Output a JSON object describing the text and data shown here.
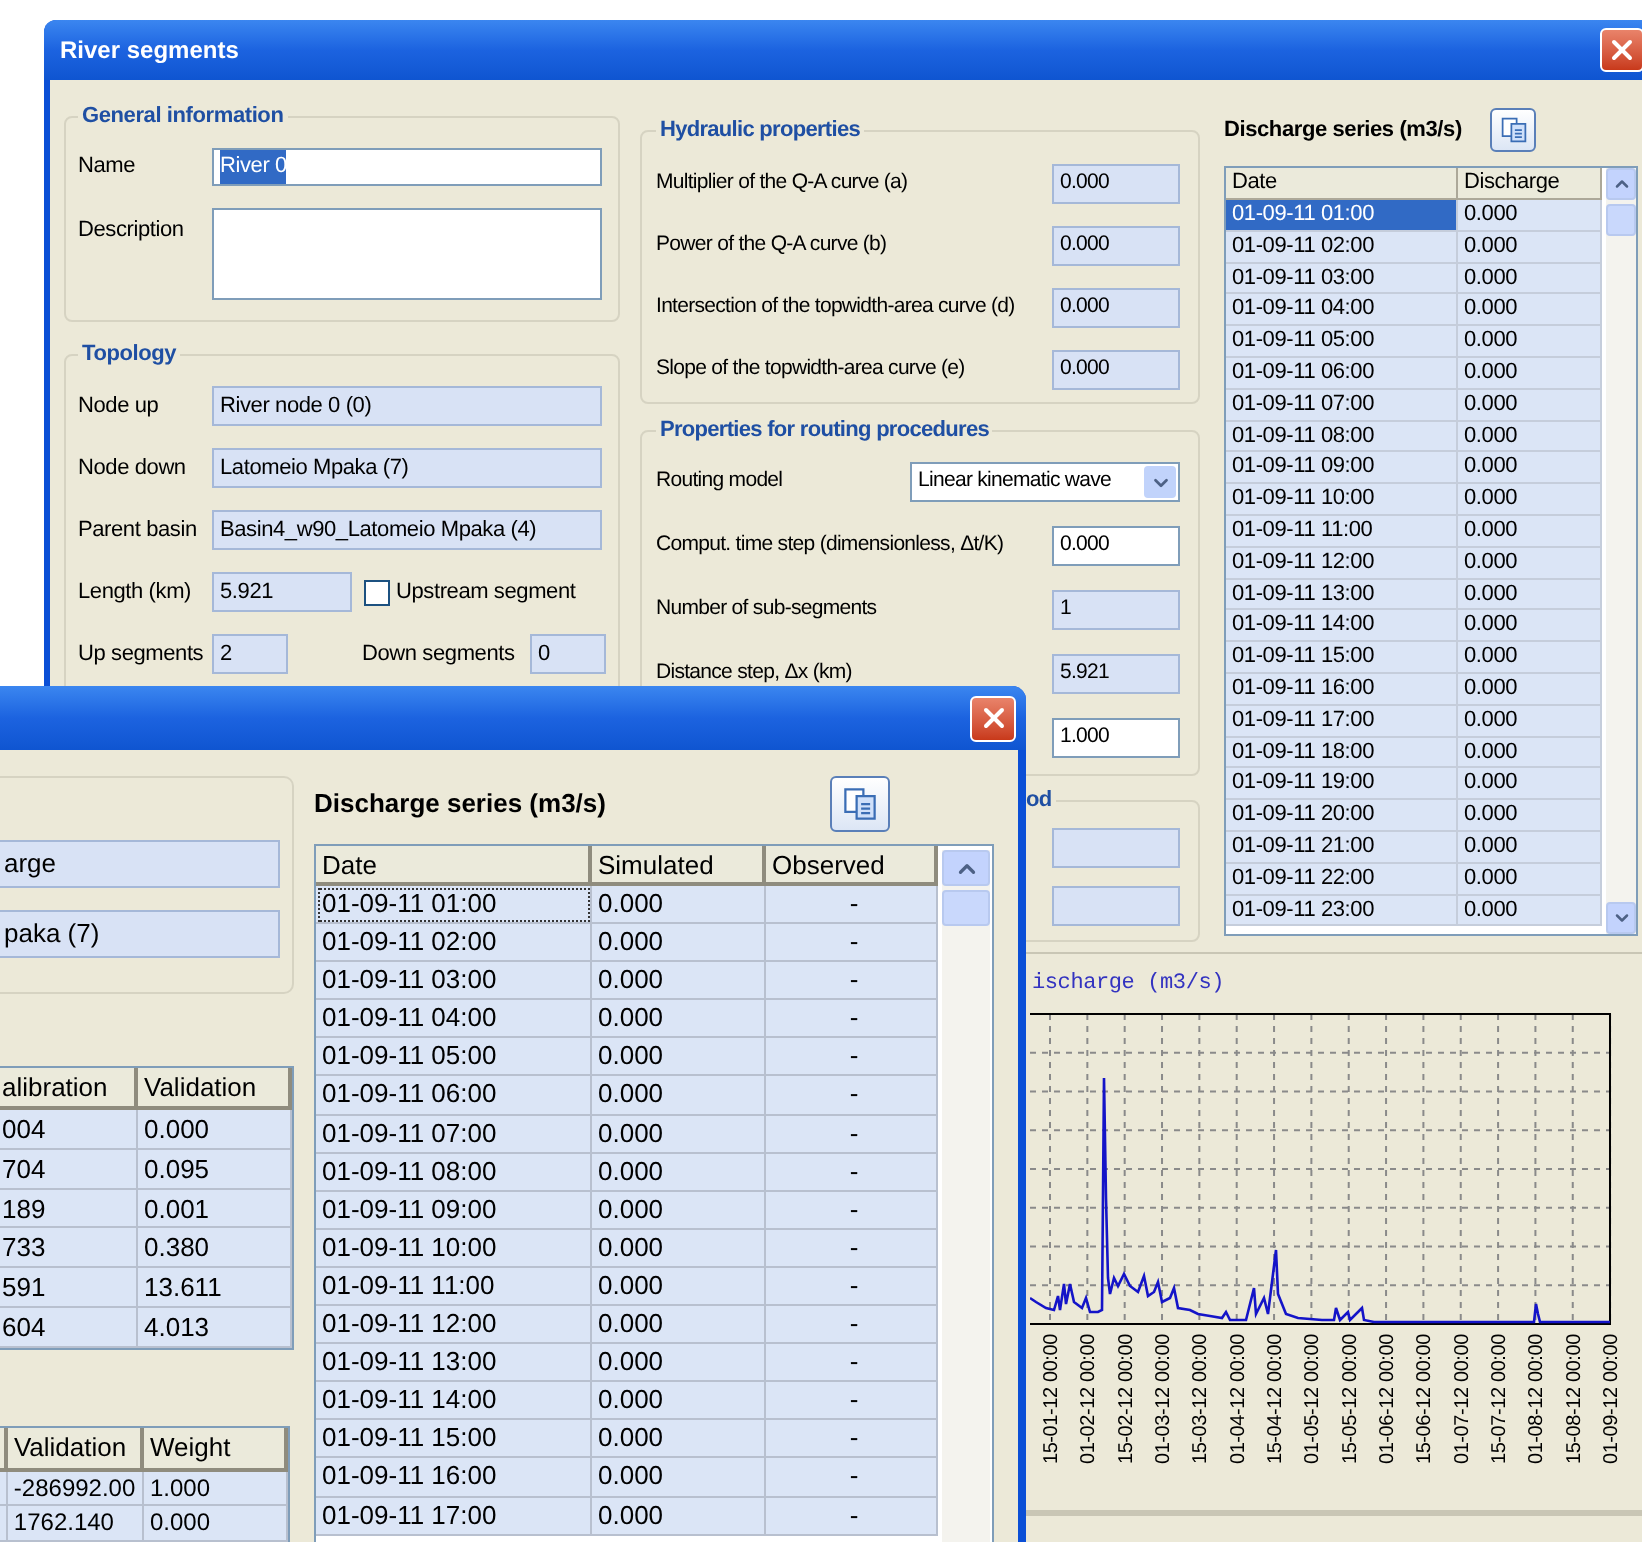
{
  "back_window": {
    "title": "River segments",
    "general": {
      "legend": "General information",
      "name": {
        "label": "Name",
        "value": "River 0",
        "editable": true,
        "text_selected": true
      },
      "description": {
        "label": "Description",
        "editable": true
      }
    },
    "topology": {
      "legend": "Topology",
      "fields": [
        {
          "label": "Node up",
          "value": "River node 0 (0)",
          "editable": false
        },
        {
          "label": "Node down",
          "value": "Latomeio Mpaka (7)",
          "editable": false
        },
        {
          "label": "Parent basin",
          "value": "Basin4_w90_Latomeio Mpaka (4)",
          "editable": false
        }
      ],
      "length": {
        "label": "Length (km)",
        "value": "5.921",
        "editable": false
      },
      "upstream_segment": {
        "label": "Upstream segment",
        "checked": false
      },
      "up_segments": {
        "label": "Up segments",
        "value": "2",
        "editable": false
      },
      "down_segments": {
        "label": "Down segments",
        "value": "0",
        "editable": false
      }
    },
    "hydraulic": {
      "legend": "Hydraulic properties",
      "fields": [
        {
          "label": "Multiplier of the Q-A curve (a)",
          "value": "0.000",
          "editable": false
        },
        {
          "label": "Power of the Q-A curve (b)",
          "value": "0.000",
          "editable": false
        },
        {
          "label": "Intersection of the topwidth-area curve (d)",
          "value": "0.000",
          "editable": false
        },
        {
          "label": "Slope of the topwidth-area curve (e)",
          "value": "0.000",
          "editable": false
        }
      ]
    },
    "routing": {
      "legend": "Properties for routing procedures",
      "fields": [
        {
          "kind": "select",
          "label": "Routing model",
          "value": "Linear kinematic wave"
        },
        {
          "kind": "input",
          "label": "Comput. time step (dimensionless, Δt/K)",
          "value": "0.000",
          "editable": true
        },
        {
          "kind": "input",
          "label": "Number of sub-segments",
          "value": "1",
          "editable": false
        },
        {
          "kind": "input",
          "label": "Distance step, Δx (km)",
          "value": "5.921",
          "editable": false
        },
        {
          "kind": "input",
          "value": "1.000",
          "editable": true
        }
      ]
    },
    "group_3": {
      "legend": "od",
      "fields": [
        {
          "editable": false
        },
        {
          "editable": false
        }
      ]
    },
    "discharge_series": {
      "title": "Discharge series (m3/s)",
      "columns": [
        "Date",
        "Discharge"
      ],
      "rows": [
        {
          "date": "01-09-11 01:00",
          "discharge": "0.000",
          "selected": true
        },
        {
          "date": "01-09-11 02:00",
          "discharge": "0.000",
          "selected": false
        },
        {
          "date": "01-09-11 03:00",
          "discharge": "0.000",
          "selected": false
        },
        {
          "date": "01-09-11 04:00",
          "discharge": "0.000",
          "selected": false
        },
        {
          "date": "01-09-11 05:00",
          "discharge": "0.000",
          "selected": false
        },
        {
          "date": "01-09-11 06:00",
          "discharge": "0.000",
          "selected": false
        },
        {
          "date": "01-09-11 07:00",
          "discharge": "0.000",
          "selected": false
        },
        {
          "date": "01-09-11 08:00",
          "discharge": "0.000",
          "selected": false
        },
        {
          "date": "01-09-11 09:00",
          "discharge": "0.000",
          "selected": false
        },
        {
          "date": "01-09-11 10:00",
          "discharge": "0.000",
          "selected": false
        },
        {
          "date": "01-09-11 11:00",
          "discharge": "0.000",
          "selected": false
        },
        {
          "date": "01-09-11 12:00",
          "discharge": "0.000",
          "selected": false
        },
        {
          "date": "01-09-11 13:00",
          "discharge": "0.000",
          "selected": false
        },
        {
          "date": "01-09-11 14:00",
          "discharge": "0.000",
          "selected": false
        },
        {
          "date": "01-09-11 15:00",
          "discharge": "0.000",
          "selected": false
        },
        {
          "date": "01-09-11 16:00",
          "discharge": "0.000",
          "selected": false
        },
        {
          "date": "01-09-11 17:00",
          "discharge": "0.000",
          "selected": false
        },
        {
          "date": "01-09-11 18:00",
          "discharge": "0.000",
          "selected": false
        },
        {
          "date": "01-09-11 19:00",
          "discharge": "0.000",
          "selected": false
        },
        {
          "date": "01-09-11 20:00",
          "discharge": "0.000",
          "selected": false
        },
        {
          "date": "01-09-11 21:00",
          "discharge": "0.000",
          "selected": false
        },
        {
          "date": "01-09-11 22:00",
          "discharge": "0.000",
          "selected": false
        },
        {
          "date": "01-09-11 23:00",
          "discharge": "0.000",
          "selected": false
        }
      ]
    },
    "chart": {
      "title": "ischarge (m3/s)",
      "x_tick_labels": [
        "15-01-12 00:00",
        "01-02-12 00:00",
        "15-02-12 00:00",
        "01-03-12 00:00",
        "15-03-12 00:00",
        "01-04-12 00:00",
        "15-04-12 00:00",
        "01-05-12 00:00",
        "15-05-12 00:00",
        "01-06-12 00:00",
        "15-06-12 00:00",
        "01-07-12 00:00",
        "15-07-12 00:00",
        "01-08-12 00:00",
        "15-08-12 00:00",
        "01-09-12 00:00"
      ]
    }
  },
  "front_window": {
    "fields": [
      {
        "value": "arge",
        "editable": false
      },
      {
        "value": "paka (7)",
        "editable": false
      }
    ],
    "metrics_table": {
      "columns": [
        "alibration",
        "Validation"
      ],
      "rows": [
        [
          "004",
          "0.000"
        ],
        [
          "704",
          "0.095"
        ],
        [
          "189",
          "0.001"
        ],
        [
          "733",
          "0.380"
        ],
        [
          "591",
          "13.611"
        ],
        [
          "604",
          "4.013"
        ]
      ]
    },
    "weights_table": {
      "columns": [
        "Validation",
        "Weight"
      ],
      "rows": [
        [
          "-286992.00",
          "1.000"
        ],
        [
          "1762.140",
          "0.000"
        ]
      ]
    },
    "discharge_series": {
      "title": "Discharge series (m3/s)",
      "columns": [
        "Date",
        "Simulated",
        "Observed"
      ],
      "rows": [
        {
          "date": "01-09-11 01:00",
          "simulated": "0.000",
          "observed": "-",
          "focused": true
        },
        {
          "date": "01-09-11 02:00",
          "simulated": "0.000",
          "observed": "-",
          "focused": false
        },
        {
          "date": "01-09-11 03:00",
          "simulated": "0.000",
          "observed": "-",
          "focused": false
        },
        {
          "date": "01-09-11 04:00",
          "simulated": "0.000",
          "observed": "-",
          "focused": false
        },
        {
          "date": "01-09-11 05:00",
          "simulated": "0.000",
          "observed": "-",
          "focused": false
        },
        {
          "date": "01-09-11 06:00",
          "simulated": "0.000",
          "observed": "-",
          "focused": false
        },
        {
          "date": "01-09-11 07:00",
          "simulated": "0.000",
          "observed": "-",
          "focused": false
        },
        {
          "date": "01-09-11 08:00",
          "simulated": "0.000",
          "observed": "-",
          "focused": false
        },
        {
          "date": "01-09-11 09:00",
          "simulated": "0.000",
          "observed": "-",
          "focused": false
        },
        {
          "date": "01-09-11 10:00",
          "simulated": "0.000",
          "observed": "-",
          "focused": false
        },
        {
          "date": "01-09-11 11:00",
          "simulated": "0.000",
          "observed": "-",
          "focused": false
        },
        {
          "date": "01-09-11 12:00",
          "simulated": "0.000",
          "observed": "-",
          "focused": false
        },
        {
          "date": "01-09-11 13:00",
          "simulated": "0.000",
          "observed": "-",
          "focused": false
        },
        {
          "date": "01-09-11 14:00",
          "simulated": "0.000",
          "observed": "-",
          "focused": false
        },
        {
          "date": "01-09-11 15:00",
          "simulated": "0.000",
          "observed": "-",
          "focused": false
        },
        {
          "date": "01-09-11 16:00",
          "simulated": "0.000",
          "observed": "-",
          "focused": false
        },
        {
          "date": "01-09-11 17:00",
          "simulated": "0.000",
          "observed": "-",
          "focused": false
        }
      ]
    }
  }
}
